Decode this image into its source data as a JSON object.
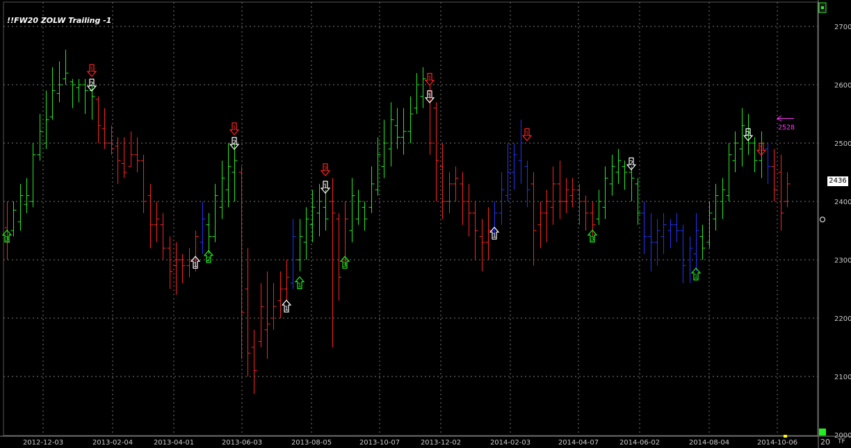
{
  "title": "!!FW20 ZOLW Trailing -1",
  "last_price_label": "2436",
  "corner_label": "20",
  "tf_label": "TF",
  "chart_data": {
    "type": "ohlc-bar",
    "y_ticks": [
      2000,
      2100,
      2200,
      2300,
      2400,
      2500,
      2600,
      2700
    ],
    "ylim": [
      2000,
      2700
    ],
    "x_tick_labels": [
      "2012-12-03",
      "2013-02-04",
      "2013-04-01",
      "2013-06-03",
      "2013-08-05",
      "2013-10-07",
      "2013-12-02",
      "2014-02-03",
      "2014-04-07",
      "2014-06-02",
      "2014-08-04",
      "2014-10-06"
    ],
    "colors": {
      "up": "#22ee22",
      "down": "#ff2222",
      "neutral": "#2233ff",
      "grid": "#7a7a7a"
    },
    "bars": [
      {
        "h": 2400,
        "l": 2300,
        "o": 2355,
        "c": 2330,
        "t": "d"
      },
      {
        "h": 2400,
        "l": 2340,
        "o": 2350,
        "c": 2385,
        "t": "u"
      },
      {
        "h": 2430,
        "l": 2350,
        "o": 2365,
        "c": 2410,
        "t": "u"
      },
      {
        "h": 2440,
        "l": 2380,
        "o": 2395,
        "c": 2410,
        "t": "u"
      },
      {
        "h": 2500,
        "l": 2390,
        "o": 2400,
        "c": 2480,
        "t": "u"
      },
      {
        "h": 2550,
        "l": 2470,
        "o": 2480,
        "c": 2520,
        "t": "u"
      },
      {
        "h": 2590,
        "l": 2490,
        "o": 2500,
        "c": 2540,
        "t": "u"
      },
      {
        "h": 2630,
        "l": 2540,
        "o": 2545,
        "c": 2590,
        "t": "u"
      },
      {
        "h": 2640,
        "l": 2570,
        "o": 2585,
        "c": 2600,
        "t": "u"
      },
      {
        "h": 2660,
        "l": 2600,
        "o": 2610,
        "c": 2620,
        "t": "u"
      },
      {
        "h": 2610,
        "l": 2560,
        "o": 2605,
        "c": 2600,
        "t": "u"
      },
      {
        "h": 2610,
        "l": 2570,
        "o": 2595,
        "c": 2600,
        "t": "u"
      },
      {
        "h": 2610,
        "l": 2550,
        "o": 2600,
        "c": 2590,
        "t": "u"
      },
      {
        "h": 2600,
        "l": 2540,
        "o": 2590,
        "c": 2580,
        "t": "u"
      },
      {
        "h": 2580,
        "l": 2500,
        "o": 2575,
        "c": 2530,
        "t": "d"
      },
      {
        "h": 2560,
        "l": 2490,
        "o": 2525,
        "c": 2500,
        "t": "d"
      },
      {
        "h": 2530,
        "l": 2480,
        "o": 2500,
        "c": 2490,
        "t": "d"
      },
      {
        "h": 2510,
        "l": 2430,
        "o": 2495,
        "c": 2470,
        "t": "d"
      },
      {
        "h": 2510,
        "l": 2440,
        "o": 2465,
        "c": 2450,
        "t": "d"
      },
      {
        "h": 2520,
        "l": 2460,
        "o": 2460,
        "c": 2480,
        "t": "d"
      },
      {
        "h": 2510,
        "l": 2450,
        "o": 2480,
        "c": 2470,
        "t": "d"
      },
      {
        "h": 2480,
        "l": 2380,
        "o": 2470,
        "c": 2400,
        "t": "d"
      },
      {
        "h": 2430,
        "l": 2320,
        "o": 2410,
        "c": 2360,
        "t": "d"
      },
      {
        "h": 2400,
        "l": 2330,
        "o": 2360,
        "c": 2370,
        "t": "d"
      },
      {
        "h": 2380,
        "l": 2300,
        "o": 2360,
        "c": 2320,
        "t": "d"
      },
      {
        "h": 2340,
        "l": 2250,
        "o": 2320,
        "c": 2280,
        "t": "d"
      },
      {
        "h": 2330,
        "l": 2240,
        "o": 2290,
        "c": 2300,
        "t": "d"
      },
      {
        "h": 2310,
        "l": 2260,
        "o": 2300,
        "c": 2290,
        "t": "d"
      },
      {
        "h": 2320,
        "l": 2270,
        "o": 2290,
        "c": 2300,
        "t": "d"
      },
      {
        "h": 2350,
        "l": 2280,
        "o": 2300,
        "c": 2340,
        "t": "d"
      },
      {
        "h": 2400,
        "l": 2310,
        "o": 2330,
        "c": 2370,
        "t": "n"
      },
      {
        "h": 2380,
        "l": 2310,
        "o": 2360,
        "c": 2340,
        "t": "u"
      },
      {
        "h": 2430,
        "l": 2330,
        "o": 2340,
        "c": 2410,
        "t": "u"
      },
      {
        "h": 2470,
        "l": 2370,
        "o": 2390,
        "c": 2440,
        "t": "u"
      },
      {
        "h": 2500,
        "l": 2390,
        "o": 2420,
        "c": 2460,
        "t": "u"
      },
      {
        "h": 2500,
        "l": 2400,
        "o": 2450,
        "c": 2470,
        "t": "u"
      },
      {
        "h": 2460,
        "l": 2130,
        "o": 2450,
        "c": 2210,
        "t": "d"
      },
      {
        "h": 2320,
        "l": 2100,
        "o": 2250,
        "c": 2140,
        "t": "d"
      },
      {
        "h": 2180,
        "l": 2070,
        "o": 2150,
        "c": 2110,
        "t": "d"
      },
      {
        "h": 2260,
        "l": 2150,
        "o": 2160,
        "c": 2220,
        "t": "d"
      },
      {
        "h": 2280,
        "l": 2130,
        "o": 2180,
        "c": 2190,
        "t": "d"
      },
      {
        "h": 2260,
        "l": 2180,
        "o": 2200,
        "c": 2220,
        "t": "d"
      },
      {
        "h": 2280,
        "l": 2200,
        "o": 2230,
        "c": 2250,
        "t": "d"
      },
      {
        "h": 2300,
        "l": 2230,
        "o": 2250,
        "c": 2270,
        "t": "d"
      },
      {
        "h": 2370,
        "l": 2250,
        "o": 2260,
        "c": 2340,
        "t": "n"
      },
      {
        "h": 2370,
        "l": 2280,
        "o": 2300,
        "c": 2340,
        "t": "u"
      },
      {
        "h": 2390,
        "l": 2300,
        "o": 2330,
        "c": 2370,
        "t": "u"
      },
      {
        "h": 2420,
        "l": 2330,
        "o": 2360,
        "c": 2390,
        "t": "u"
      },
      {
        "h": 2430,
        "l": 2340,
        "o": 2380,
        "c": 2400,
        "t": "u"
      },
      {
        "h": 2420,
        "l": 2350,
        "o": 2390,
        "c": 2370,
        "t": "u"
      },
      {
        "h": 2440,
        "l": 2150,
        "o": 2400,
        "c": 2380,
        "t": "d"
      },
      {
        "h": 2380,
        "l": 2230,
        "o": 2370,
        "c": 2270,
        "t": "d"
      },
      {
        "h": 2400,
        "l": 2290,
        "o": 2300,
        "c": 2370,
        "t": "d"
      },
      {
        "h": 2440,
        "l": 2330,
        "o": 2350,
        "c": 2410,
        "t": "u"
      },
      {
        "h": 2420,
        "l": 2360,
        "o": 2370,
        "c": 2400,
        "t": "u"
      },
      {
        "h": 2400,
        "l": 2350,
        "o": 2390,
        "c": 2370,
        "t": "u"
      },
      {
        "h": 2460,
        "l": 2380,
        "o": 2390,
        "c": 2430,
        "t": "u"
      },
      {
        "h": 2510,
        "l": 2410,
        "o": 2420,
        "c": 2480,
        "t": "u"
      },
      {
        "h": 2540,
        "l": 2440,
        "o": 2460,
        "c": 2500,
        "t": "u"
      },
      {
        "h": 2570,
        "l": 2460,
        "o": 2490,
        "c": 2540,
        "t": "u"
      },
      {
        "h": 2560,
        "l": 2490,
        "o": 2530,
        "c": 2510,
        "t": "u"
      },
      {
        "h": 2560,
        "l": 2480,
        "o": 2510,
        "c": 2520,
        "t": "u"
      },
      {
        "h": 2580,
        "l": 2500,
        "o": 2520,
        "c": 2550,
        "t": "u"
      },
      {
        "h": 2620,
        "l": 2550,
        "o": 2560,
        "c": 2600,
        "t": "u"
      },
      {
        "h": 2630,
        "l": 2560,
        "o": 2580,
        "c": 2610,
        "t": "u"
      },
      {
        "h": 2600,
        "l": 2480,
        "o": 2590,
        "c": 2500,
        "t": "d"
      },
      {
        "h": 2570,
        "l": 2400,
        "o": 2560,
        "c": 2470,
        "t": "d"
      },
      {
        "h": 2500,
        "l": 2370,
        "o": 2460,
        "c": 2400,
        "t": "d"
      },
      {
        "h": 2450,
        "l": 2380,
        "o": 2400,
        "c": 2430,
        "t": "d"
      },
      {
        "h": 2460,
        "l": 2400,
        "o": 2430,
        "c": 2440,
        "t": "d"
      },
      {
        "h": 2450,
        "l": 2360,
        "o": 2430,
        "c": 2400,
        "t": "d"
      },
      {
        "h": 2430,
        "l": 2340,
        "o": 2400,
        "c": 2380,
        "t": "d"
      },
      {
        "h": 2400,
        "l": 2300,
        "o": 2380,
        "c": 2350,
        "t": "d"
      },
      {
        "h": 2370,
        "l": 2280,
        "o": 2340,
        "c": 2330,
        "t": "d"
      },
      {
        "h": 2390,
        "l": 2300,
        "o": 2330,
        "c": 2350,
        "t": "d"
      },
      {
        "h": 2400,
        "l": 2340,
        "o": 2350,
        "c": 2380,
        "t": "n"
      },
      {
        "h": 2450,
        "l": 2360,
        "o": 2380,
        "c": 2420,
        "t": "n"
      },
      {
        "h": 2500,
        "l": 2400,
        "o": 2410,
        "c": 2450,
        "t": "n"
      },
      {
        "h": 2500,
        "l": 2420,
        "o": 2450,
        "c": 2480,
        "t": "n"
      },
      {
        "h": 2540,
        "l": 2430,
        "o": 2470,
        "c": 2500,
        "t": "n"
      },
      {
        "h": 2470,
        "l": 2390,
        "o": 2460,
        "c": 2420,
        "t": "n"
      },
      {
        "h": 2450,
        "l": 2290,
        "o": 2430,
        "c": 2350,
        "t": "d"
      },
      {
        "h": 2400,
        "l": 2320,
        "o": 2360,
        "c": 2380,
        "t": "d"
      },
      {
        "h": 2420,
        "l": 2330,
        "o": 2380,
        "c": 2400,
        "t": "d"
      },
      {
        "h": 2460,
        "l": 2360,
        "o": 2390,
        "c": 2430,
        "t": "d"
      },
      {
        "h": 2470,
        "l": 2370,
        "o": 2430,
        "c": 2400,
        "t": "d"
      },
      {
        "h": 2440,
        "l": 2380,
        "o": 2400,
        "c": 2420,
        "t": "d"
      },
      {
        "h": 2440,
        "l": 2390,
        "o": 2410,
        "c": 2420,
        "t": "d"
      },
      {
        "h": 2430,
        "l": 2360,
        "o": 2420,
        "c": 2400,
        "t": "d"
      },
      {
        "h": 2410,
        "l": 2350,
        "o": 2400,
        "c": 2380,
        "t": "d"
      },
      {
        "h": 2400,
        "l": 2340,
        "o": 2380,
        "c": 2360,
        "t": "d"
      },
      {
        "h": 2420,
        "l": 2360,
        "o": 2370,
        "c": 2400,
        "t": "u"
      },
      {
        "h": 2460,
        "l": 2370,
        "o": 2390,
        "c": 2440,
        "t": "u"
      },
      {
        "h": 2480,
        "l": 2410,
        "o": 2430,
        "c": 2460,
        "t": "u"
      },
      {
        "h": 2490,
        "l": 2430,
        "o": 2450,
        "c": 2470,
        "t": "u"
      },
      {
        "h": 2470,
        "l": 2420,
        "o": 2460,
        "c": 2450,
        "t": "u"
      },
      {
        "h": 2460,
        "l": 2400,
        "o": 2450,
        "c": 2440,
        "t": "u"
      },
      {
        "h": 2440,
        "l": 2360,
        "o": 2430,
        "c": 2380,
        "t": "u"
      },
      {
        "h": 2400,
        "l": 2310,
        "o": 2380,
        "c": 2340,
        "t": "n"
      },
      {
        "h": 2380,
        "l": 2280,
        "o": 2340,
        "c": 2330,
        "t": "n"
      },
      {
        "h": 2370,
        "l": 2290,
        "o": 2330,
        "c": 2350,
        "t": "n"
      },
      {
        "h": 2380,
        "l": 2310,
        "o": 2340,
        "c": 2360,
        "t": "n"
      },
      {
        "h": 2370,
        "l": 2320,
        "o": 2350,
        "c": 2360,
        "t": "n"
      },
      {
        "h": 2380,
        "l": 2330,
        "o": 2360,
        "c": 2350,
        "t": "n"
      },
      {
        "h": 2360,
        "l": 2260,
        "o": 2350,
        "c": 2290,
        "t": "n"
      },
      {
        "h": 2340,
        "l": 2260,
        "o": 2300,
        "c": 2320,
        "t": "n"
      },
      {
        "h": 2380,
        "l": 2280,
        "o": 2310,
        "c": 2350,
        "t": "n"
      },
      {
        "h": 2360,
        "l": 2300,
        "o": 2340,
        "c": 2320,
        "t": "u"
      },
      {
        "h": 2400,
        "l": 2320,
        "o": 2330,
        "c": 2380,
        "t": "u"
      },
      {
        "h": 2430,
        "l": 2350,
        "o": 2370,
        "c": 2410,
        "t": "u"
      },
      {
        "h": 2440,
        "l": 2370,
        "o": 2400,
        "c": 2420,
        "t": "u"
      },
      {
        "h": 2500,
        "l": 2400,
        "o": 2410,
        "c": 2480,
        "t": "u"
      },
      {
        "h": 2520,
        "l": 2450,
        "o": 2470,
        "c": 2500,
        "t": "u"
      },
      {
        "h": 2560,
        "l": 2460,
        "o": 2490,
        "c": 2530,
        "t": "u"
      },
      {
        "h": 2550,
        "l": 2480,
        "o": 2520,
        "c": 2500,
        "t": "u"
      },
      {
        "h": 2510,
        "l": 2450,
        "o": 2500,
        "c": 2470,
        "t": "u"
      },
      {
        "h": 2520,
        "l": 2440,
        "o": 2470,
        "c": 2500,
        "t": "u"
      },
      {
        "h": 2500,
        "l": 2430,
        "o": 2490,
        "c": 2460,
        "t": "n"
      },
      {
        "h": 2490,
        "l": 2400,
        "o": 2460,
        "c": 2420,
        "t": "d"
      },
      {
        "h": 2480,
        "l": 2350,
        "o": 2450,
        "c": 2380,
        "t": "d"
      },
      {
        "h": 2450,
        "l": 2390,
        "o": 2400,
        "c": 2430,
        "t": "d"
      }
    ],
    "signals": [
      {
        "bar": 0,
        "dir": "up",
        "color": "green",
        "label": "3",
        "pos": 2340
      },
      {
        "bar": 13,
        "dir": "down",
        "color": "red",
        "label": "1",
        "pos": 2625
      },
      {
        "bar": 13,
        "dir": "down",
        "color": "white",
        "label": "2",
        "pos": 2600
      },
      {
        "bar": 29,
        "dir": "up",
        "color": "white",
        "label": "1",
        "pos": 2295
      },
      {
        "bar": 31,
        "dir": "up",
        "color": "green",
        "label": "2",
        "pos": 2305
      },
      {
        "bar": 35,
        "dir": "down",
        "color": "red",
        "label": "1",
        "pos": 2525
      },
      {
        "bar": 35,
        "dir": "down",
        "color": "white",
        "label": "2",
        "pos": 2500
      },
      {
        "bar": 43,
        "dir": "up",
        "color": "white",
        "label": "1",
        "pos": 2220
      },
      {
        "bar": 45,
        "dir": "up",
        "color": "green",
        "label": "1",
        "pos": 2260
      },
      {
        "bar": 49,
        "dir": "down",
        "color": "red",
        "label": "2",
        "pos": 2455
      },
      {
        "bar": 49,
        "dir": "down",
        "color": "white",
        "label": "1",
        "pos": 2425
      },
      {
        "bar": 52,
        "dir": "up",
        "color": "green",
        "label": "3",
        "pos": 2295
      },
      {
        "bar": 65,
        "dir": "down",
        "color": "red",
        "label": "1",
        "pos": 2610
      },
      {
        "bar": 65,
        "dir": "down",
        "color": "white",
        "label": "1",
        "pos": 2580
      },
      {
        "bar": 75,
        "dir": "up",
        "color": "white",
        "label": "1",
        "pos": 2345
      },
      {
        "bar": 80,
        "dir": "down",
        "color": "red",
        "label": "1",
        "pos": 2515
      },
      {
        "bar": 90,
        "dir": "up",
        "color": "green",
        "label": "3",
        "pos": 2340
      },
      {
        "bar": 96,
        "dir": "down",
        "color": "white",
        "label": "2",
        "pos": 2465
      },
      {
        "bar": 106,
        "dir": "up",
        "color": "green",
        "label": "1",
        "pos": 2275
      },
      {
        "bar": 114,
        "dir": "down",
        "color": "white",
        "label": "2",
        "pos": 2515
      },
      {
        "bar": 116,
        "dir": "down",
        "color": "red",
        "label": "1",
        "pos": 2490
      }
    ],
    "annotation": {
      "text": "2528",
      "value": 2528,
      "color": "#ff33ff"
    }
  }
}
